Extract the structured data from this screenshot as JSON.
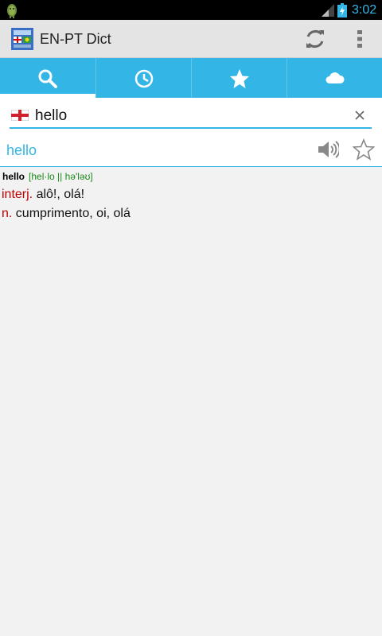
{
  "status_bar": {
    "time": "3:02",
    "icons": [
      "android-robot-icon",
      "signal-icon",
      "battery-icon"
    ]
  },
  "action_bar": {
    "title": "EN-PT Dict",
    "icons": [
      "dictionary-app-icon",
      "refresh-icon",
      "overflow-menu-icon"
    ]
  },
  "tabs": [
    {
      "name": "search",
      "icon": "search-icon",
      "active": true
    },
    {
      "name": "history",
      "icon": "clock-icon",
      "active": false
    },
    {
      "name": "favorites",
      "icon": "star-icon",
      "active": false
    },
    {
      "name": "cloud",
      "icon": "cloud-icon",
      "active": false
    }
  ],
  "search": {
    "value": "hello",
    "language_flag": "england-flag-icon"
  },
  "word_row": {
    "word": "hello"
  },
  "entry": {
    "headword": "hello",
    "pronunciation": "[hel·lo || hə'ləʊ]",
    "senses": [
      {
        "pos": "interj.",
        "text": "alô!, olá!"
      },
      {
        "pos": "n.",
        "text": "cumprimento, oi, olá"
      }
    ]
  },
  "colors": {
    "accent": "#33b5e5",
    "pos_red": "#c00000",
    "pronunciation_green": "#1a8a1a",
    "background": "#f2f2f2"
  }
}
